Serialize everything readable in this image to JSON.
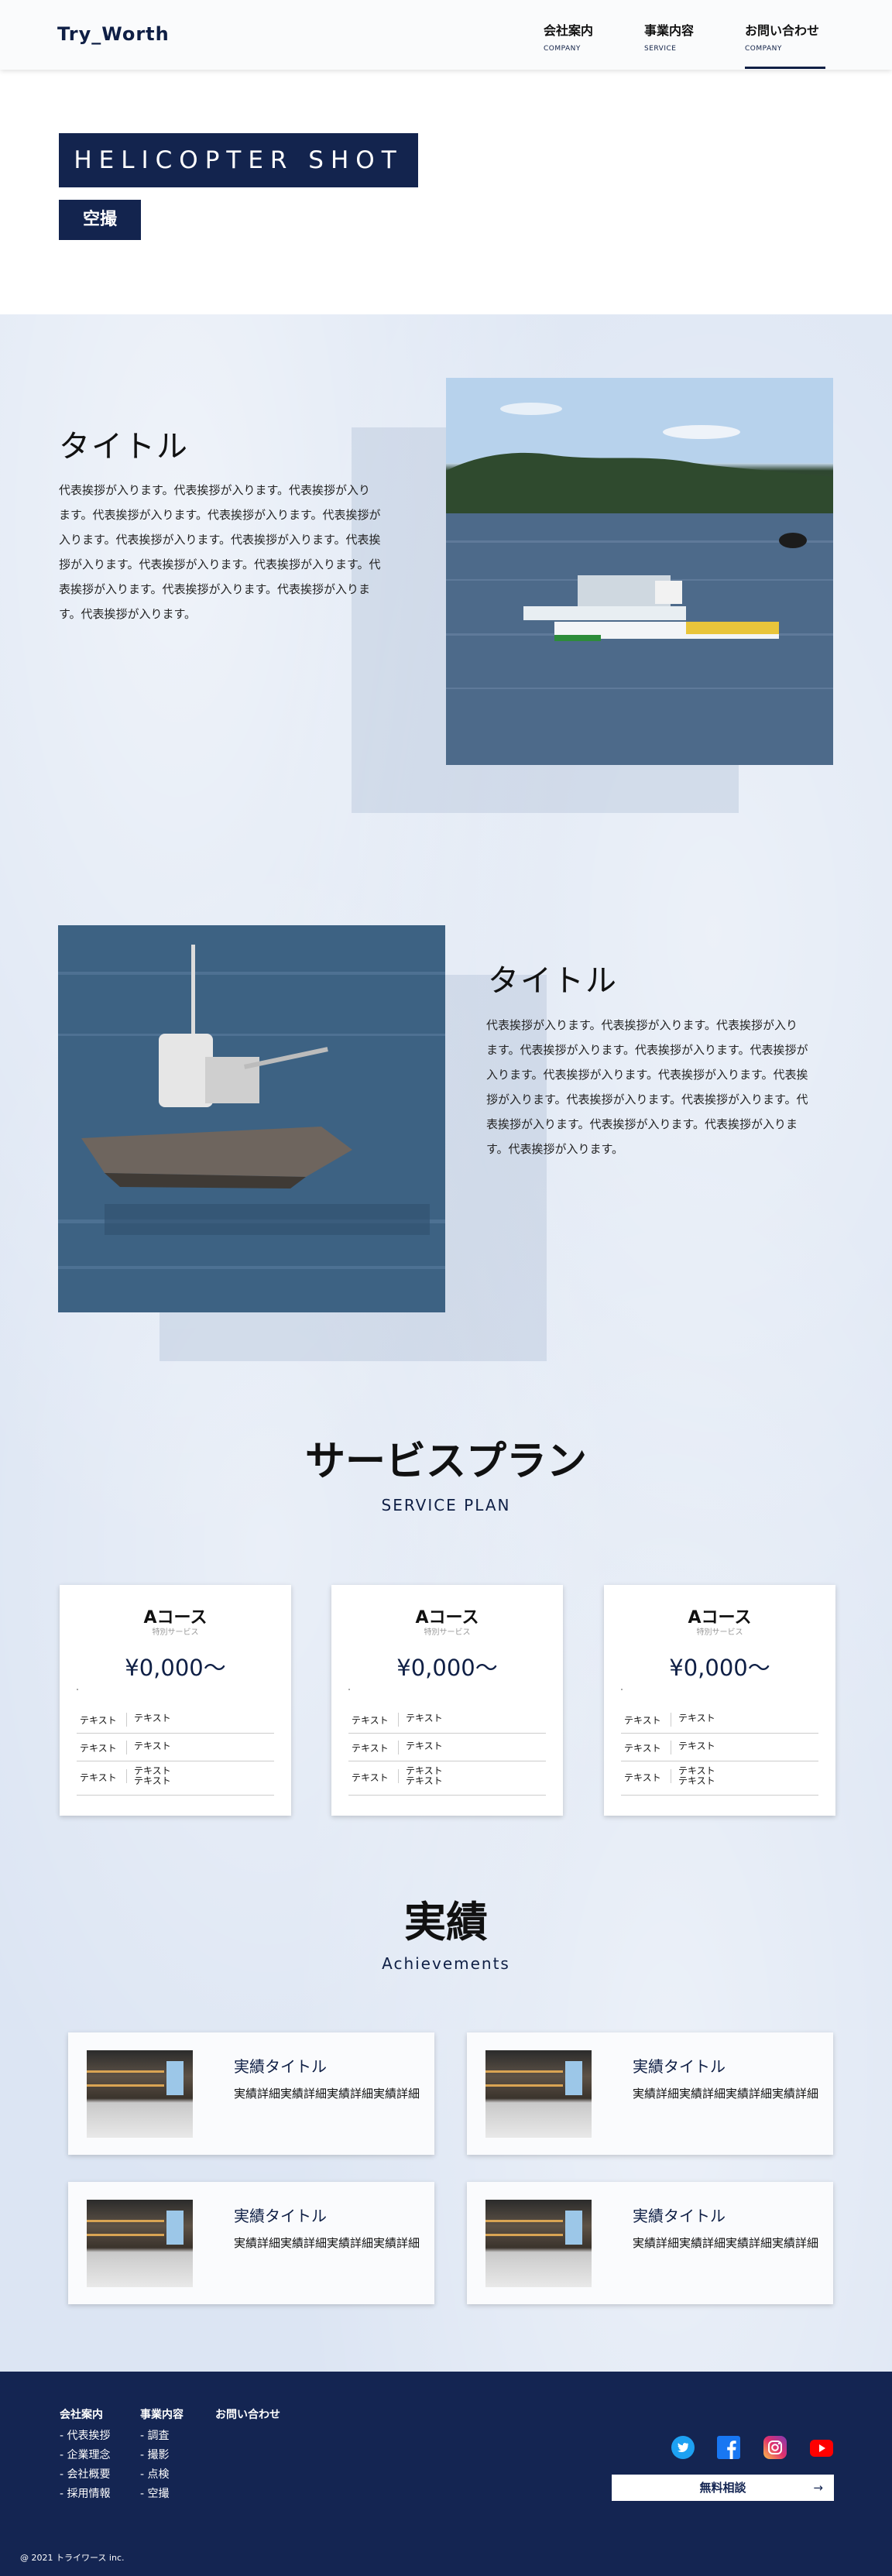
{
  "header": {
    "logo": "Try_Worth",
    "nav": [
      {
        "jp": "会社案内",
        "en": "COMPANY"
      },
      {
        "jp": "事業内容",
        "en": "SERVICE"
      },
      {
        "jp": "お問い合わせ",
        "en": "COMPANY"
      }
    ]
  },
  "hero": {
    "title": "HELICOPTER SHOT",
    "subtitle": "空撮"
  },
  "features": [
    {
      "title": "タイトル",
      "text": "代表挨拶が入ります。代表挨拶が入ります。代表挨拶が入ります。代表挨拶が入ります。代表挨拶が入ります。代表挨拶が入ります。代表挨拶が入ります。代表挨拶が入ります。代表挨拶が入ります。代表挨拶が入ります。代表挨拶が入ります。代表挨拶が入ります。代表挨拶が入ります。代表挨拶が入ります。代表挨拶が入ります。"
    },
    {
      "title": "タイトル",
      "text": "代表挨拶が入ります。代表挨拶が入ります。代表挨拶が入ります。代表挨拶が入ります。代表挨拶が入ります。代表挨拶が入ります。代表挨拶が入ります。代表挨拶が入ります。代表挨拶が入ります。代表挨拶が入ります。代表挨拶が入ります。代表挨拶が入ります。代表挨拶が入ります。代表挨拶が入ります。代表挨拶が入ります。"
    }
  ],
  "plans_section": {
    "title": "サービスプラン",
    "subtitle": "SERVICE PLAN"
  },
  "plans": [
    {
      "name": "Aコース",
      "tag": "特別サービス",
      "price": "¥0,000〜",
      "rows": [
        {
          "label": "テキスト",
          "value": "テキスト"
        },
        {
          "label": "テキスト",
          "value": "テキスト"
        },
        {
          "label": "テキスト",
          "value": "テキスト\nテキスト"
        }
      ]
    },
    {
      "name": "Aコース",
      "tag": "特別サービス",
      "price": "¥0,000〜",
      "rows": [
        {
          "label": "テキスト",
          "value": "テキスト"
        },
        {
          "label": "テキスト",
          "value": "テキスト"
        },
        {
          "label": "テキスト",
          "value": "テキスト\nテキスト"
        }
      ]
    },
    {
      "name": "Aコース",
      "tag": "特別サービス",
      "price": "¥0,000〜",
      "rows": [
        {
          "label": "テキスト",
          "value": "テキスト"
        },
        {
          "label": "テキスト",
          "value": "テキスト"
        },
        {
          "label": "テキスト",
          "value": "テキスト\nテキスト"
        }
      ]
    }
  ],
  "achievements_section": {
    "title": "実績",
    "subtitle": "Achievements"
  },
  "achievements": [
    {
      "title": "実績タイトル",
      "desc": "実績詳細実績詳細実績詳細実績詳細"
    },
    {
      "title": "実績タイトル",
      "desc": "実績詳細実績詳細実績詳細実績詳細"
    },
    {
      "title": "実績タイトル",
      "desc": "実績詳細実績詳細実績詳細実績詳細"
    },
    {
      "title": "実績タイトル",
      "desc": "実績詳細実績詳細実績詳細実績詳細"
    }
  ],
  "footer": {
    "columns": [
      {
        "heading": "会社案内",
        "links": [
          "- 代表挨拶",
          "- 企業理念",
          "- 会社概要",
          "- 採用情報"
        ]
      },
      {
        "heading": "事業内容",
        "links": [
          "- 調査",
          "- 撮影",
          "- 点検",
          "- 空撮"
        ]
      },
      {
        "heading": "お問い合わせ",
        "links": []
      }
    ],
    "social": [
      {
        "icon": "twitter-icon",
        "color": "#1da1f2"
      },
      {
        "icon": "facebook-icon",
        "color": "#1877f2"
      },
      {
        "icon": "instagram-icon",
        "color": "#d6249f"
      },
      {
        "icon": "youtube-icon",
        "color": "#ff0000"
      }
    ],
    "consult_label": "無料相談",
    "consult_arrow": "→",
    "copyright": "@ 2021 トライワース inc."
  }
}
